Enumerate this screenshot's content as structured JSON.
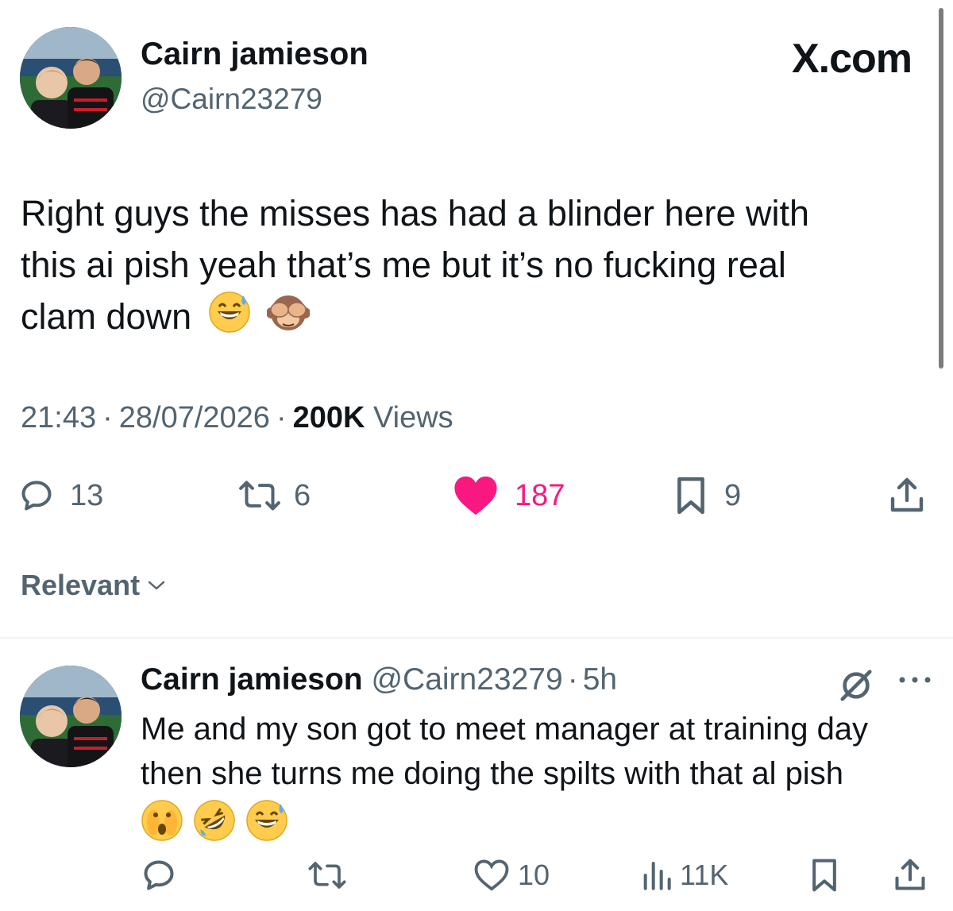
{
  "brand": {
    "label": "X.com"
  },
  "tweet": {
    "author_name": "Cairn jamieson",
    "author_handle": "@Cairn23279",
    "text_line1": "Right guys the misses has had a blinder here with",
    "text_line2": "this ai pish yeah that’s me but it’s no fucking real",
    "text_line3": "clam down",
    "time": "21:43",
    "date": "28/07/2026",
    "separator": "·",
    "views_count": "200K",
    "views_label": "Views",
    "stats": {
      "replies": "13",
      "reposts": "6",
      "likes": "187",
      "bookmarks": "9"
    },
    "like_color": "#f91880"
  },
  "sort": {
    "label": "Relevant"
  },
  "reply": {
    "author_name": "Cairn jamieson",
    "author_handle": "@Cairn23279",
    "separator": "·",
    "time": "5h",
    "text_line1": "Me and my son got to meet manager at training day",
    "text_line2": "then she turns me doing the spilts with that al pish",
    "stats": {
      "likes": "10",
      "views": "11K"
    }
  },
  "colors": {
    "text": "#0f1419",
    "secondary": "#536471",
    "divider": "#eff3f4"
  }
}
